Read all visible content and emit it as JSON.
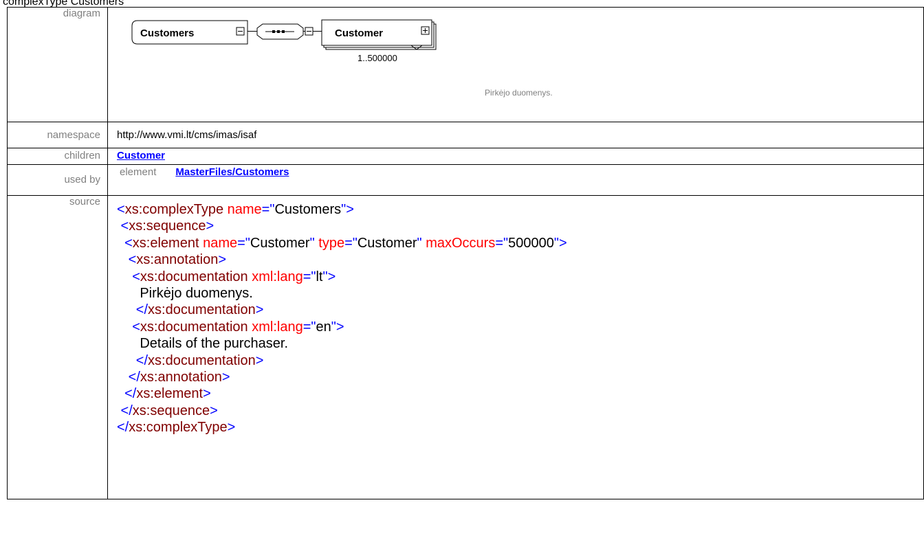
{
  "heading": "complexType Customers",
  "rows": {
    "diagram": {
      "label": "diagram"
    },
    "namespace": {
      "label": "namespace",
      "value": "http://www.vmi.lt/cms/imas/isaf"
    },
    "children": {
      "label": "children",
      "link": "Customer"
    },
    "used_by": {
      "label": "used by",
      "kind": "element",
      "link": "MasterFiles/Customers"
    },
    "source": {
      "label": "source"
    }
  },
  "diagram": {
    "root_name": "Customers",
    "child_name": "Customer",
    "occurrence": "1..500000",
    "documentation": "Pirkėjo duomenys."
  },
  "source_lines": [
    [
      [
        "t",
        "<"
      ],
      [
        "tn",
        "xs:complexType"
      ],
      [
        "an",
        " name"
      ],
      [
        "t",
        "=\""
      ],
      [
        "av",
        "Customers"
      ],
      [
        "t",
        "\">"
      ]
    ],
    [
      [
        "t",
        " <"
      ],
      [
        "tn",
        "xs:sequence"
      ],
      [
        "t",
        ">"
      ]
    ],
    [
      [
        "t",
        "  <"
      ],
      [
        "tn",
        "xs:element"
      ],
      [
        "an",
        " name"
      ],
      [
        "t",
        "=\""
      ],
      [
        "av",
        "Customer"
      ],
      [
        "t",
        "\""
      ],
      [
        "an",
        " type"
      ],
      [
        "t",
        "=\""
      ],
      [
        "av",
        "Customer"
      ],
      [
        "t",
        "\""
      ],
      [
        "an",
        " maxOccurs"
      ],
      [
        "t",
        "=\""
      ],
      [
        "av",
        "500000"
      ],
      [
        "t",
        "\">"
      ]
    ],
    [
      [
        "t",
        "   <"
      ],
      [
        "tn",
        "xs:annotation"
      ],
      [
        "t",
        ">"
      ]
    ],
    [
      [
        "t",
        "    <"
      ],
      [
        "tn",
        "xs:documentation"
      ],
      [
        "an",
        " xml:lang"
      ],
      [
        "t",
        "=\""
      ],
      [
        "av",
        "lt"
      ],
      [
        "t",
        "\">"
      ]
    ],
    [
      [
        "tx",
        "      Pirkėjo duomenys."
      ]
    ],
    [
      [
        "t",
        "     </"
      ],
      [
        "tn",
        "xs:documentation"
      ],
      [
        "t",
        ">"
      ]
    ],
    [
      [
        "t",
        "    <"
      ],
      [
        "tn",
        "xs:documentation"
      ],
      [
        "an",
        " xml:lang"
      ],
      [
        "t",
        "=\""
      ],
      [
        "av",
        "en"
      ],
      [
        "t",
        "\">"
      ]
    ],
    [
      [
        "tx",
        "      Details of the purchaser."
      ]
    ],
    [
      [
        "t",
        "     </"
      ],
      [
        "tn",
        "xs:documentation"
      ],
      [
        "t",
        ">"
      ]
    ],
    [
      [
        "t",
        "   </"
      ],
      [
        "tn",
        "xs:annotation"
      ],
      [
        "t",
        ">"
      ]
    ],
    [
      [
        "t",
        "  </"
      ],
      [
        "tn",
        "xs:element"
      ],
      [
        "t",
        ">"
      ]
    ],
    [
      [
        "t",
        " </"
      ],
      [
        "tn",
        "xs:sequence"
      ],
      [
        "t",
        ">"
      ]
    ],
    [
      [
        "t",
        "</"
      ],
      [
        "tn",
        "xs:complexType"
      ],
      [
        "t",
        ">"
      ]
    ]
  ]
}
